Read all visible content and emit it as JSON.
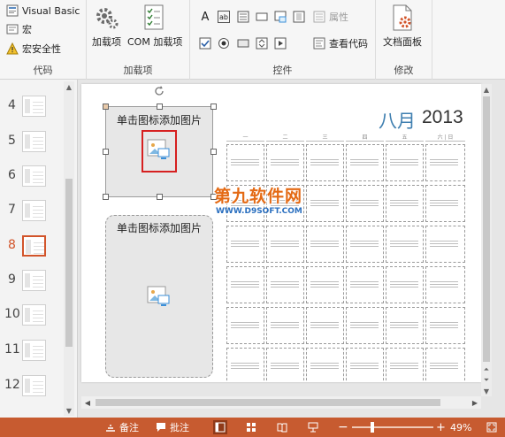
{
  "ribbon": {
    "code": {
      "label": "代码",
      "visual_basic": "Visual Basic",
      "macro": "宏",
      "macro_security": "宏安全性"
    },
    "addins": {
      "label": "加载项",
      "addin": "加载项",
      "com_addin": "COM 加载项"
    },
    "controls": {
      "label": "控件",
      "properties": "属性",
      "view_code": "查看代码",
      "text_glyph": "A",
      "textbox_glyph": "ab"
    },
    "modify": {
      "label": "修改",
      "document_panel": "文档面板"
    }
  },
  "thumbnails": {
    "numbers": [
      "4",
      "5",
      "6",
      "7",
      "8",
      "9",
      "10",
      "11",
      "12"
    ],
    "selected": "8"
  },
  "slide": {
    "placeholder_1": "单击图标添加图片",
    "placeholder_2": "单击图标添加图片",
    "calendar_month": "八月",
    "calendar_year": "2013",
    "day_headers": [
      "一",
      "二",
      "三",
      "四",
      "五",
      "六 | 日"
    ],
    "watermark_main": "第九软件网",
    "watermark_sub": "WWW.D9SOFT.COM"
  },
  "status": {
    "notes": "备注",
    "comments": "批注",
    "zoom": "49%",
    "zoom_level_fraction": 0.49,
    "minus": "−",
    "plus": "+"
  },
  "colors": {
    "accent": "#c75b30",
    "selection": "#d2542a",
    "calendar_blue": "#3f7fb0",
    "watermark_orange": "#e46a14",
    "watermark_blue": "#2a6fbf"
  }
}
